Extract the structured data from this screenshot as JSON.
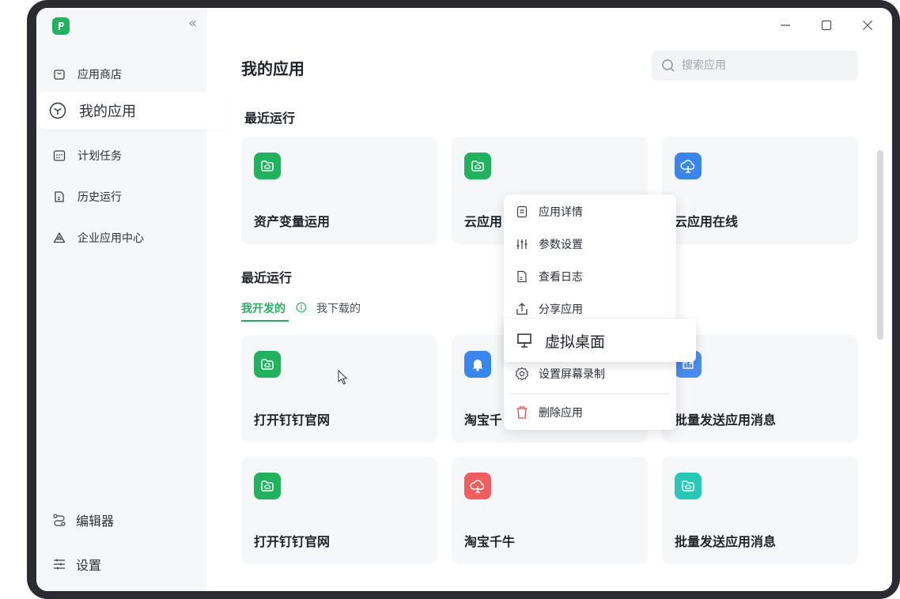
{
  "sidebar": {
    "collapse_glyph": "«",
    "items": [
      {
        "label": "应用商店",
        "icon": "store-bag-icon"
      },
      {
        "label": "我的应用",
        "icon": "cube-icon"
      },
      {
        "label": "计划任务",
        "icon": "calendar-icon"
      },
      {
        "label": "历史运行",
        "icon": "document-icon"
      },
      {
        "label": "企业应用中心",
        "icon": "triangle-icon"
      }
    ],
    "bottom": [
      {
        "label": "编辑器",
        "icon": "path-icon"
      },
      {
        "label": "设置",
        "icon": "sliders-icon"
      }
    ]
  },
  "header": {
    "title": "我的应用",
    "search_placeholder": "搜索应用"
  },
  "sections": {
    "recent1": "最近运行",
    "recent2": "最近运行"
  },
  "tabs": [
    {
      "label": "我开发的",
      "active": true
    },
    {
      "label": "我下载的",
      "active": false
    }
  ],
  "recent_cards": [
    {
      "name": "资产变量运用",
      "color": "#1fb35d",
      "icon": "cloud-folder-icon"
    },
    {
      "name": "云应用",
      "color": "#1fb35d",
      "icon": "cloud-folder-icon"
    },
    {
      "name": "云应用在线",
      "color": "#3a86f0",
      "icon": "cloud-upload-icon"
    }
  ],
  "dev_cards_row1": [
    {
      "name": "打开钉钉官网",
      "color": "#1fb35d",
      "icon": "cloud-folder-icon"
    },
    {
      "name": "淘宝千",
      "color": "#3a86f0",
      "icon": "bell-icon"
    },
    {
      "name": "批量发送应用消息",
      "color": "#4a8df5",
      "icon": "chart-icon"
    }
  ],
  "dev_cards_row2": [
    {
      "name": "打开钉钉官网",
      "color": "#1fb35d",
      "icon": "cloud-folder-icon"
    },
    {
      "name": "淘宝千牛",
      "color": "#f25d5d",
      "icon": "cloud-upload-icon"
    },
    {
      "name": "批量发送应用消息",
      "color": "#26c9b6",
      "icon": "cloud-folder-icon"
    }
  ],
  "context_menu": {
    "items": [
      {
        "label": "应用详情",
        "icon": "detail-icon"
      },
      {
        "label": "参数设置",
        "icon": "param-sliders-icon"
      },
      {
        "label": "查看日志",
        "icon": "log-icon"
      },
      {
        "label": "分享应用",
        "icon": "share-icon"
      },
      {
        "label": "设置屏幕录制",
        "icon": "gear-icon"
      },
      {
        "label": "删除应用",
        "icon": "trash-icon"
      }
    ],
    "hover_item": {
      "label": "虚拟桌面",
      "icon": "desktop-icon"
    },
    "danger_color": "#f04b4b"
  },
  "colors": {
    "accent": "#1fb35d",
    "sidebar_bg": "#f6f7f8",
    "card_bg": "#f6f7f9"
  }
}
